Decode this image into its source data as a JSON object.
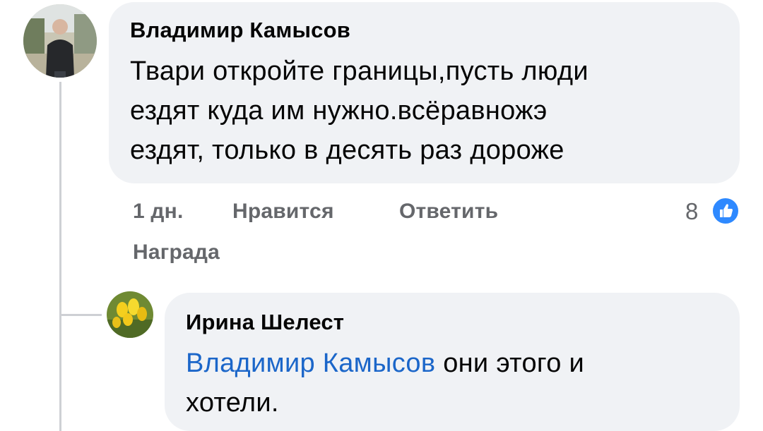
{
  "comment": {
    "author": "Владимир Камысов",
    "text_lines": [
      "Твари откройте границы,пусть люди",
      "ездят куда им нужно.всёравножэ",
      "ездят, только в десять раз дороже"
    ],
    "time": "1 дн.",
    "like_label": "Нравится",
    "reply_label": "Ответить",
    "award_label": "Награда",
    "reaction_count": "8",
    "reaction_icon": "like-icon",
    "colors": {
      "bubble": "#f0f2f5",
      "secondary_text": "#65676b",
      "like_blue": "#2e89ff"
    }
  },
  "reply": {
    "author": "Ирина Шелест",
    "mention": "Владимир Камысов",
    "text_after_mention": " они этого и",
    "text_line2": "хотели.",
    "colors": {
      "mention": "#1b66c9"
    }
  }
}
